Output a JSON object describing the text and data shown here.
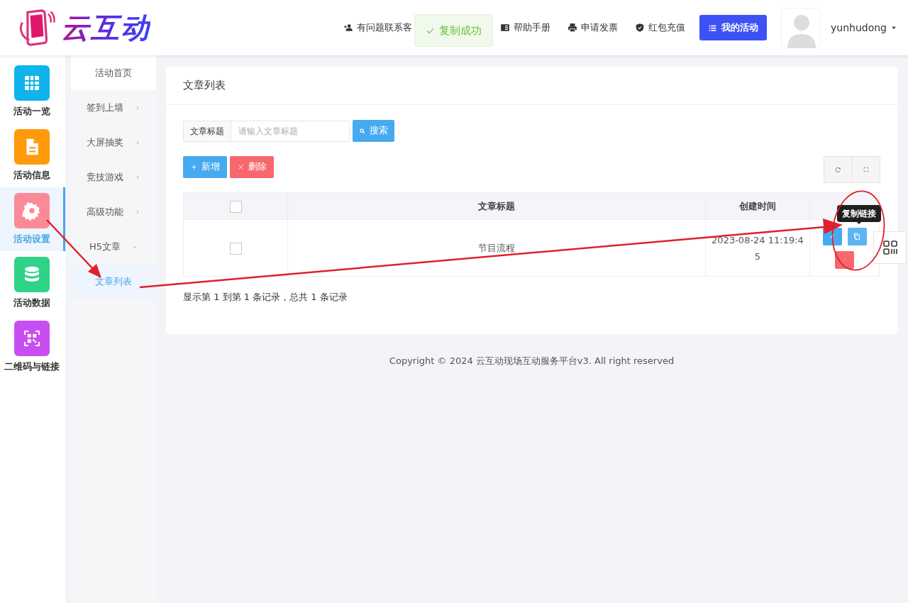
{
  "logo": {
    "text": "云互动"
  },
  "header_links": [
    {
      "kind": "contact",
      "label": "有问题联系客"
    },
    {
      "kind": "help",
      "label": "帮助手册"
    },
    {
      "kind": "invoice",
      "label": "申请发票"
    },
    {
      "kind": "redpacket",
      "label": "红包充值"
    }
  ],
  "toast": {
    "text": "复制成功"
  },
  "my_activity_button": "我的活动",
  "user": {
    "name": "yunhudong"
  },
  "main_nav": [
    {
      "kind": "grid",
      "label": "活动一览",
      "color": "#10b4ea",
      "selected": false
    },
    {
      "kind": "document",
      "label": "活动信息",
      "color": "#ff9a0a",
      "selected": false
    },
    {
      "kind": "gear",
      "label": "活动设置",
      "color": "#fb8a98",
      "selected": true
    },
    {
      "kind": "database",
      "label": "活动数据",
      "color": "#2ed388",
      "selected": false
    },
    {
      "kind": "qr",
      "label": "二维码与链接",
      "color": "#c94ef2",
      "selected": false
    }
  ],
  "sub_nav": [
    {
      "label": "活动首页",
      "has_children": false,
      "selected": false
    },
    {
      "label": "签到上墙",
      "has_children": true,
      "expanded": false,
      "selected": false
    },
    {
      "label": "大屏抽奖",
      "has_children": true,
      "expanded": false,
      "selected": false
    },
    {
      "label": "竞技游戏",
      "has_children": true,
      "expanded": false,
      "selected": false
    },
    {
      "label": "高级功能",
      "has_children": true,
      "expanded": false,
      "selected": false
    },
    {
      "label": "H5文章",
      "has_children": true,
      "expanded": true,
      "selected": false,
      "children": [
        {
          "label": "文章列表",
          "selected": true
        }
      ]
    }
  ],
  "page_title": "文章列表",
  "search": {
    "label": "文章标题",
    "placeholder": "请输入文章标题",
    "button": "搜索"
  },
  "toolbar": {
    "add": "新增",
    "delete": "删除"
  },
  "table": {
    "columns": [
      "文章标题",
      "创建时间"
    ],
    "all_checked": false,
    "rows": [
      {
        "checked": false,
        "title": "节目流程",
        "created": "2023-08-24 11:19:45"
      }
    ]
  },
  "tooltip": "复制链接",
  "pagination_info": "显示第 1 到第 1 条记录，总共 1 条记录",
  "footer": "Copyright © 2024 云互动现场互动服务平台v3. All right reserved"
}
